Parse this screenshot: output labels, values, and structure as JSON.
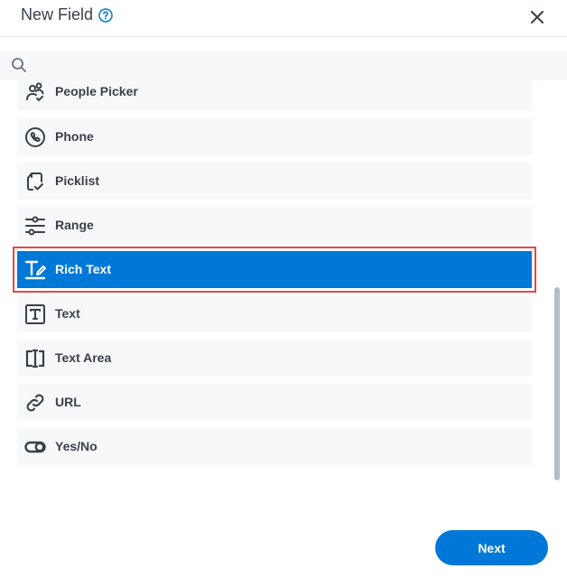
{
  "dialog": {
    "title": "New Field",
    "help_icon": "question-circle-icon",
    "close_icon": "close-icon"
  },
  "search": {
    "value": "",
    "placeholder": "",
    "icon": "search-icon"
  },
  "items": [
    {
      "label": "People Picker",
      "icon": "people-picker-icon",
      "selected": false
    },
    {
      "label": "Phone",
      "icon": "phone-icon",
      "selected": false
    },
    {
      "label": "Picklist",
      "icon": "picklist-icon",
      "selected": false
    },
    {
      "label": "Range",
      "icon": "range-sliders-icon",
      "selected": false
    },
    {
      "label": "Rich Text",
      "icon": "rich-text-icon",
      "selected": true
    },
    {
      "label": "Text",
      "icon": "text-icon",
      "selected": false
    },
    {
      "label": "Text Area",
      "icon": "text-area-icon",
      "selected": false
    },
    {
      "label": "URL",
      "icon": "link-icon",
      "selected": false
    },
    {
      "label": "Yes/No",
      "icon": "toggle-icon",
      "selected": false
    }
  ],
  "footer": {
    "next_label": "Next"
  },
  "colors": {
    "accent": "#0078d7",
    "selection_outline": "#e84545",
    "item_bg": "#f7f8fa",
    "text": "#3a3f4b"
  }
}
